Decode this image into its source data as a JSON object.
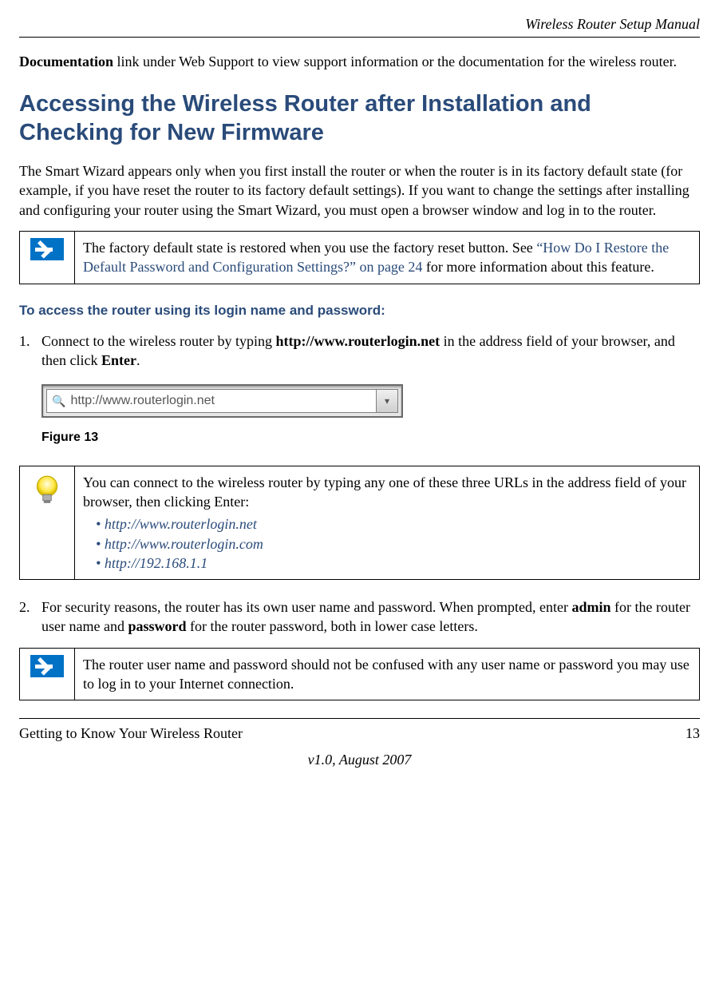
{
  "header": {
    "running_title": "Wireless Router Setup Manual"
  },
  "lead_paragraph": {
    "bold": "Documentation",
    "rest": " link under Web Support to view support information or the documentation for the wireless router."
  },
  "section_title": "Accessing the Wireless Router after Installation and Checking for New Firmware",
  "intro_para": "The Smart Wizard appears only when you first install the router or when the router is in its factory default state (for example, if you have reset the router to its factory default settings). If you want to change the settings after installing and configuring your router using the Smart Wizard, you must open a browser window and log in to the router.",
  "note1": {
    "pre": "The factory default state is restored when you use the factory reset button. See ",
    "link": "“How Do I Restore the Default Password and Configuration Settings?” on page 24",
    "post": " for more information about this feature."
  },
  "subhead": "To access the router using its login name and password:",
  "step1": {
    "num": "1.",
    "t1": "Connect to the wireless router by typing ",
    "b1": "http://www.routerlogin.net",
    "t2": " in the address field of your browser, and then click ",
    "b2": "Enter",
    "t3": "."
  },
  "addrbar_text": "http://www.routerlogin.net",
  "figure_caption": "Figure 13",
  "tip": {
    "intro": "You can connect to the wireless router by typing any one of these three URLs in the address field of your browser, then clicking Enter:",
    "urls": [
      "http://www.routerlogin.net",
      "http://www.routerlogin.com",
      "http://192.168.1.1"
    ]
  },
  "step2": {
    "num": "2.",
    "t1": "For security reasons, the router has its own user name and password. When prompted, enter ",
    "b1": "admin",
    "t2": " for the router user name and ",
    "b2": "password",
    "t3": " for the router password, both in lower case letters."
  },
  "note2": {
    "text": "The router user name and password should not be confused with any user name or password you may use to log in to your Internet connection."
  },
  "footer": {
    "section": "Getting to Know Your Wireless Router",
    "page": "13",
    "version": "v1.0, August 2007"
  }
}
